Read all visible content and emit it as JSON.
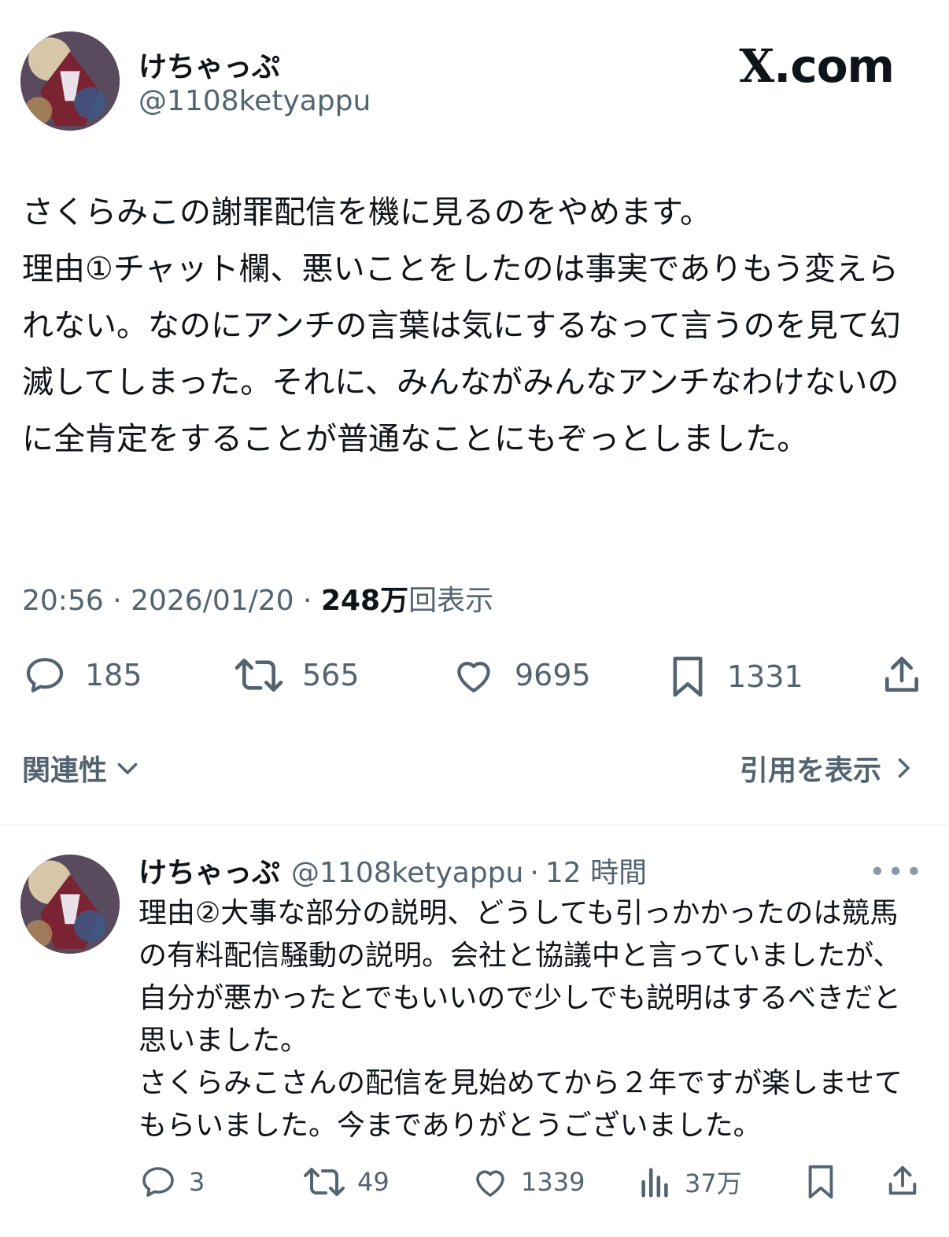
{
  "brand": {
    "text": ".com",
    "mark": "X"
  },
  "main_tweet": {
    "display_name": "けちゃっぷ",
    "handle": "@1108ketyappu",
    "text": "さくらみこの謝罪配信を機に見るのをやめます。\n理由①チャット欄、悪いことをしたのは事実でありもう変えられない。なのにアンチの言葉は気にするなって言うのを見て幻滅してしまった。それに、みんながみんなアンチなわけないのに全肯定をすることが普通なことにもぞっとしました。",
    "time": "20:56",
    "date": "2026/01/20",
    "views_number": "248万",
    "views_label": "回表示",
    "separator": " · ",
    "stats": {
      "replies": "185",
      "retweets": "565",
      "likes": "9695",
      "bookmarks": "1331"
    },
    "relevance_label": "関連性",
    "show_quotes_label": "引用を表示"
  },
  "reply_tweet": {
    "display_name": "けちゃっぷ",
    "handle": "@1108ketyappu",
    "dot": "·",
    "time": "12 時間",
    "more": "•••",
    "text": "理由②大事な部分の説明、どうしても引っかかったのは競馬の有料配信騒動の説明。会社と協議中と言っていましたが、自分が悪かったとでもいいので少しでも説明はするべきだと思いました。\nさくらみこさんの配信を見始めてから２年ですが楽しませてもらいました。今までありがとうございました。",
    "stats": {
      "replies": "3",
      "retweets": "49",
      "likes": "1339",
      "views": "37万"
    }
  },
  "icons": {
    "reply": "reply-icon",
    "retweet": "retweet-icon",
    "like": "heart-icon",
    "bookmark": "bookmark-icon",
    "share": "share-icon",
    "views": "views-icon",
    "chevron_down": "chevron-down-icon",
    "chevron_right": "chevron-right-icon"
  },
  "colors": {
    "text": "#0f1419",
    "secondary": "#536471",
    "divider": "#eff3f4"
  }
}
